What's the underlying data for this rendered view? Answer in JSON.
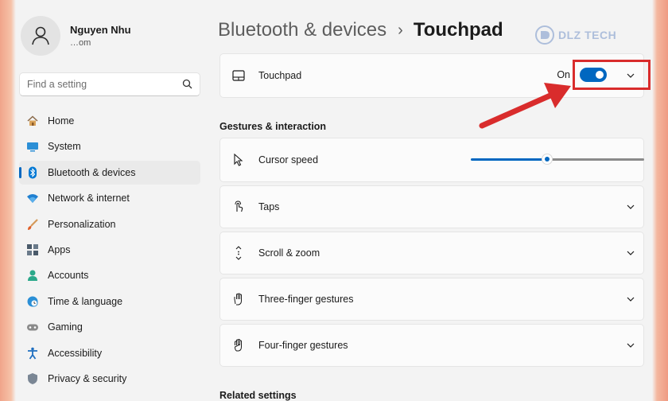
{
  "user": {
    "name": "Nguyen Nhu",
    "email": "…om"
  },
  "search": {
    "placeholder": "Find a setting"
  },
  "sidebar": {
    "items": [
      {
        "label": "Home",
        "icon": "home-icon"
      },
      {
        "label": "System",
        "icon": "system-icon"
      },
      {
        "label": "Bluetooth & devices",
        "icon": "bluetooth-icon",
        "active": true
      },
      {
        "label": "Network & internet",
        "icon": "wifi-icon"
      },
      {
        "label": "Personalization",
        "icon": "brush-icon"
      },
      {
        "label": "Apps",
        "icon": "apps-icon"
      },
      {
        "label": "Accounts",
        "icon": "account-icon"
      },
      {
        "label": "Time & language",
        "icon": "clock-globe-icon"
      },
      {
        "label": "Gaming",
        "icon": "gamepad-icon"
      },
      {
        "label": "Accessibility",
        "icon": "accessibility-icon"
      },
      {
        "label": "Privacy & security",
        "icon": "shield-icon"
      }
    ]
  },
  "header": {
    "parent": "Bluetooth & devices",
    "separator": "›",
    "current": "Touchpad"
  },
  "watermark": {
    "text": "DLZ TECH"
  },
  "touchpad": {
    "label": "Touchpad",
    "state": "On",
    "enabled": true
  },
  "gestures": {
    "title": "Gestures & interaction",
    "cursor_speed": {
      "label": "Cursor speed",
      "value_fraction": 0.44
    },
    "taps": "Taps",
    "scroll_zoom": "Scroll & zoom",
    "three_finger": "Three-finger gestures",
    "four_finger": "Four-finger gestures"
  },
  "related": {
    "title": "Related settings"
  },
  "colors": {
    "accent": "#0067c0",
    "highlight": "#d92c2c",
    "background": "#f3f3f3",
    "card": "#fbfbfb"
  }
}
